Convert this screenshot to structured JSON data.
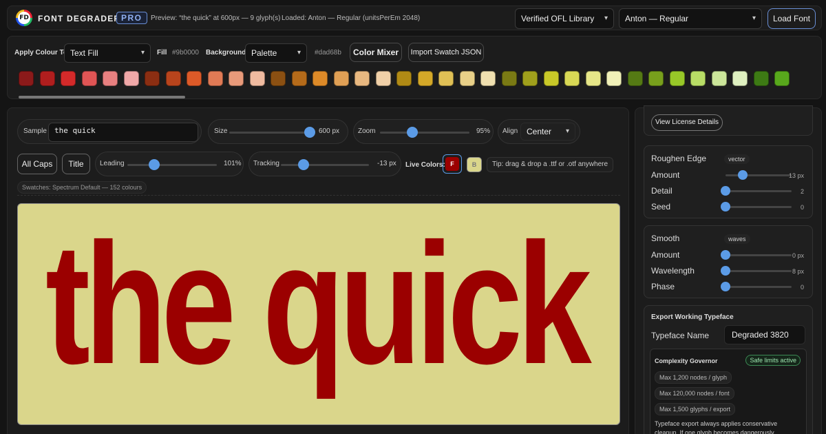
{
  "header": {
    "logo_text": "FD",
    "brand": "FONT DEGRADER",
    "badge": "PRO",
    "preview_status": "Preview: “the quick” at 600px — 9 glyph(s)",
    "loaded_status": "Loaded: Anton — Regular (unitsPerEm 2048)",
    "library_select": "Verified OFL Library",
    "font_select": "Anton — Regular",
    "load_button": "Load Font"
  },
  "colorbar": {
    "apply_label": "Apply Colour To",
    "apply_select": "Text Fill",
    "fill_label": "Fill",
    "fill_value": "#9b0000",
    "background_label": "Background",
    "background_select": "Palette",
    "background_value": "#dad68b",
    "color_mixer_button": "Color Mixer",
    "import_button": "Import Swatch JSON",
    "swatches": [
      "#8b1a1a",
      "#b01e1e",
      "#d42a2a",
      "#e05555",
      "#e88080",
      "#f0a8a8",
      "#8b2e12",
      "#b8441c",
      "#dd5a28",
      "#e07a55",
      "#e89a7a",
      "#f0bba0",
      "#8b5012",
      "#b56b1a",
      "#dd8a28",
      "#e0a055",
      "#e8b880",
      "#f0d0a8",
      "#b08a15",
      "#d4a828",
      "#e0c055",
      "#e8d088",
      "#f0e0b0",
      "#7a7a14",
      "#a0a01c",
      "#c8c828",
      "#d8d855",
      "#e6e688",
      "#f0f0b8",
      "#557a14",
      "#78a01c",
      "#98c828",
      "#b8dd66",
      "#cce69a",
      "#dff0c0",
      "#3d7a14",
      "#58a81c"
    ]
  },
  "controls": {
    "sample_label": "Sample",
    "sample_value": "the quick",
    "size_label": "Size",
    "size_value": "600 px",
    "size_level": 0.96,
    "zoom_label": "Zoom",
    "zoom_value": "95%",
    "zoom_level": 0.36,
    "align_label": "Align",
    "align_select": "Center",
    "all_caps_button": "All Caps",
    "title_button": "Title",
    "leading_label": "Leading",
    "leading_value": "101%",
    "leading_level": 0.3,
    "tracking_label": "Tracking",
    "tracking_value": "-13 px",
    "tracking_level": 0.26,
    "live_colors_label": "Live Colors:",
    "live_fill_letter": "F",
    "live_bg_letter": "B",
    "tip": "Tip: drag & drop a .ttf or .otf anywhere",
    "swatches_info": "Swatches: Spectrum Default — 152 colours"
  },
  "preview": {
    "text": "the quick",
    "fill": "#9b0000",
    "background": "#dad68b"
  },
  "sidebar": {
    "license_button": "View License Details",
    "roughen": {
      "title": "Roughen Edge",
      "mode": "vector",
      "rows": [
        {
          "label": "Amount",
          "value": "13 px",
          "level": 0.26
        },
        {
          "label": "Detail",
          "value": "2",
          "level": 0.0
        },
        {
          "label": "Seed",
          "value": "0",
          "level": 0.0
        }
      ]
    },
    "smooth": {
      "title": "Smooth",
      "mode": "waves",
      "rows": [
        {
          "label": "Amount",
          "value": "0 px",
          "level": 0.0
        },
        {
          "label": "Wavelength",
          "value": "8 px",
          "level": 0.0
        },
        {
          "label": "Phase",
          "value": "0",
          "level": 0.0
        }
      ]
    },
    "export": {
      "title": "Export Working Typeface",
      "name_label": "Typeface Name",
      "name_value": "Degraded 3820",
      "governor_title": "Complexity Governor",
      "governor_status": "Safe limits active",
      "limits": [
        "Max 1,200 nodes / glyph",
        "Max 120,000 nodes / font",
        "Max 1,500 glyphs / export"
      ],
      "note": "Typeface export always applies conservative cleanup. If one glyph becomes dangerously"
    }
  }
}
